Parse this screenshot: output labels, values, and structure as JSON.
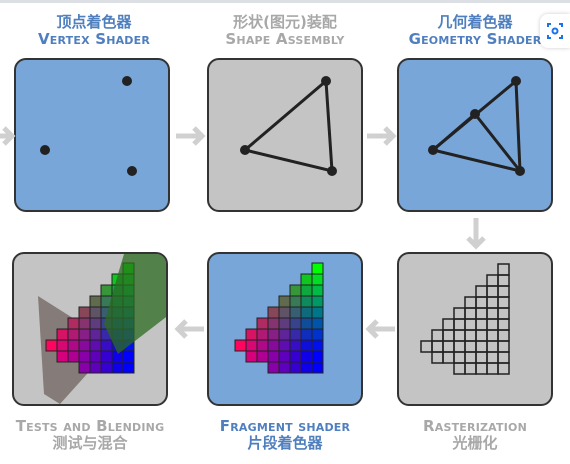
{
  "stages": [
    {
      "zh": "顶点着色器",
      "en": "Vertex Shader"
    },
    {
      "zh": "形状(图元)装配",
      "en": "Shape Assembly"
    },
    {
      "zh": "几何着色器",
      "en": "Geometry Shader"
    },
    {
      "zh": "光栅化",
      "en": "Rasterization"
    },
    {
      "zh": "片段着色器",
      "en": "Fragment shader"
    },
    {
      "zh": "测试与混合",
      "en": "Tests and Blending"
    }
  ],
  "colors": {
    "active_blue": "#78a6d8",
    "inactive_gray": "#c4c4c4",
    "label_blue": "#4f7fbf",
    "label_gray": "#a8a8a8",
    "arrow": "#d0d0d0"
  },
  "overlay": {
    "icon": "screenshot-lens-icon"
  }
}
